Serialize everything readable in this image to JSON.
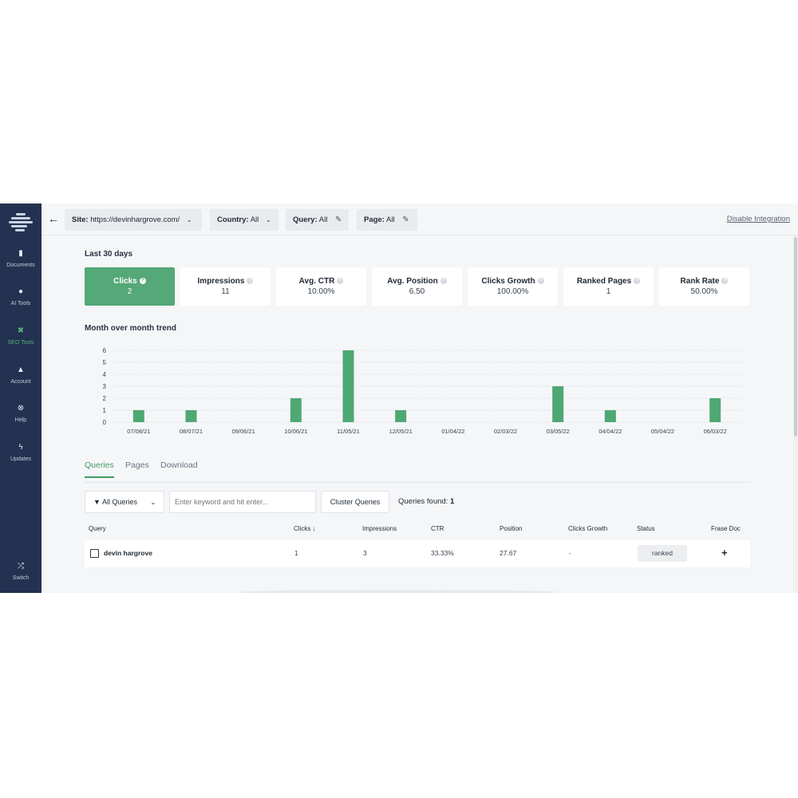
{
  "sidebar": {
    "items": [
      {
        "label": "Documents",
        "icon": "document-icon",
        "glyph": "▮"
      },
      {
        "label": "AI Tools",
        "icon": "robot-icon",
        "glyph": "●"
      },
      {
        "label": "SEO Tools",
        "icon": "tools-icon",
        "glyph": "✖"
      },
      {
        "label": "Account",
        "icon": "user-icon",
        "glyph": "▲"
      },
      {
        "label": "Help",
        "icon": "lifebuoy-icon",
        "glyph": "⊗"
      },
      {
        "label": "Updates",
        "icon": "bolt-icon",
        "glyph": "ϟ"
      }
    ],
    "switch": {
      "label": "Switch",
      "icon": "shuffle-icon",
      "glyph": "⤮"
    }
  },
  "topbar": {
    "site": {
      "key": "Site:",
      "value": "https://devinhargrove.com/"
    },
    "country": {
      "key": "Country:",
      "value": "All"
    },
    "query": {
      "key": "Query:",
      "value": "All"
    },
    "page": {
      "key": "Page:",
      "value": "All"
    },
    "disable_label": "Disable Integration"
  },
  "period_title": "Last 30 days",
  "metrics": [
    {
      "label": "Clicks",
      "value": "2",
      "active": true
    },
    {
      "label": "Impressions",
      "value": "11"
    },
    {
      "label": "Avg. CTR",
      "value": "10.00%"
    },
    {
      "label": "Avg. Position",
      "value": "6.50"
    },
    {
      "label": "Clicks Growth",
      "value": "100.00%"
    },
    {
      "label": "Ranked Pages",
      "value": "1"
    },
    {
      "label": "Rank Rate",
      "value": "50.00%"
    }
  ],
  "trend_title": "Month over month trend",
  "chart_data": {
    "type": "bar",
    "title": "",
    "ylim": [
      0,
      6
    ],
    "yticks": [
      0,
      1,
      2,
      3,
      4,
      5,
      6
    ],
    "categories": [
      "07/08/21",
      "08/07/21",
      "09/06/21",
      "10/06/21",
      "11/05/21",
      "12/05/21",
      "01/04/22",
      "02/03/22",
      "03/05/22",
      "04/04/22",
      "05/04/22",
      "06/03/22"
    ],
    "values": [
      1,
      1,
      0,
      2,
      6,
      1,
      0,
      0,
      3,
      1,
      0,
      2
    ],
    "color": "#4ea874",
    "grid": true
  },
  "tabs": [
    "Queries",
    "Pages",
    "Download"
  ],
  "filters": {
    "all_queries": "All Queries",
    "search_placeholder": "Enter keyword and hit enter...",
    "cluster": "Cluster Queries",
    "found_label": "Queries found:",
    "found_count": "1"
  },
  "table": {
    "headers": [
      "Query",
      "Clicks",
      "Impressions",
      "CTR",
      "Position",
      "Clicks Growth",
      "Status",
      "Frase Doc"
    ],
    "sort_indicator": "↓",
    "rows": [
      {
        "query": "devin hargrove",
        "clicks": "1",
        "impressions": "3",
        "ctr": "33.33%",
        "position": "27.67",
        "growth": "-",
        "status": "ranked"
      }
    ]
  },
  "colors": {
    "sidebar": "#223250",
    "accent": "#55a877",
    "background": "#f5f6f8"
  }
}
